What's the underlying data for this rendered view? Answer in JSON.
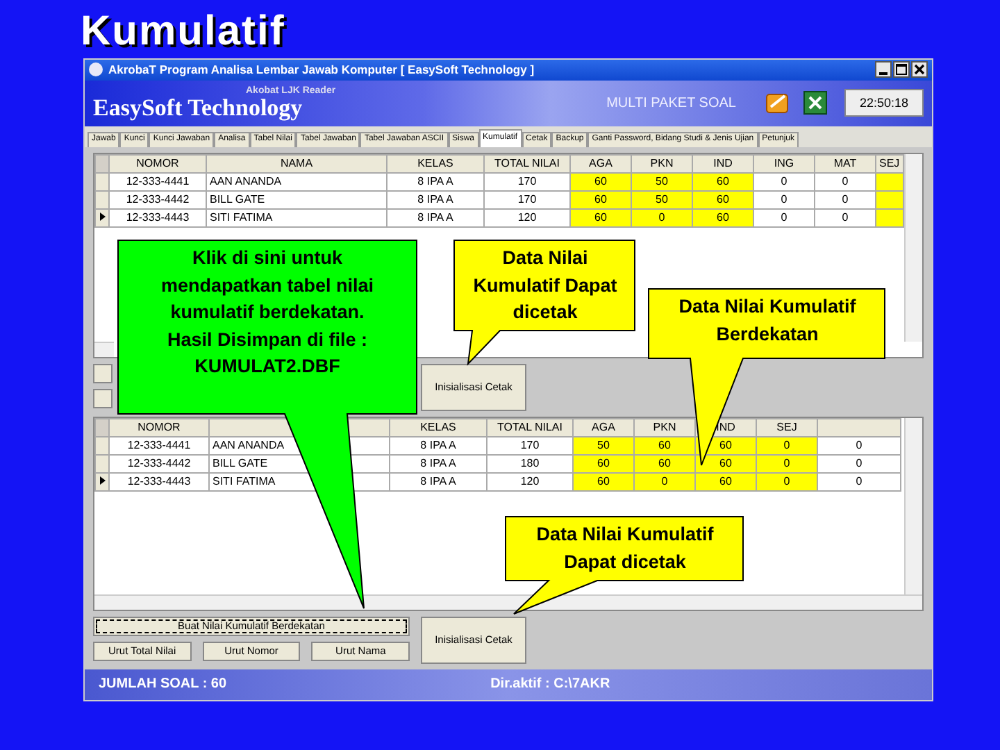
{
  "slide": {
    "title": "Kumulatif"
  },
  "window": {
    "title": "AkrobaT   Program Analisa Lembar Jawab Komputer  [ EasySoft Technology ]"
  },
  "header": {
    "subtitle": "Akobat LJK Reader",
    "brand": "EasySoft Technology",
    "label": "MULTI PAKET SOAL",
    "clock": "22:50:18"
  },
  "tabs": [
    {
      "label": "Jawab",
      "selected": false
    },
    {
      "label": "Kunci",
      "selected": false
    },
    {
      "label": "Kunci Jawaban",
      "selected": false
    },
    {
      "label": "Analisa",
      "selected": false
    },
    {
      "label": "Tabel Nilai",
      "selected": false
    },
    {
      "label": "Tabel Jawaban",
      "selected": false
    },
    {
      "label": "Tabel Jawaban ASCII",
      "selected": false
    },
    {
      "label": "Siswa",
      "selected": false
    },
    {
      "label": "Kumulatif",
      "selected": true
    },
    {
      "label": "Cetak",
      "selected": false
    },
    {
      "label": "Backup",
      "selected": false
    },
    {
      "label": "Ganti Password, Bidang Studi & Jenis Ujian",
      "selected": false
    },
    {
      "label": "Petunjuk",
      "selected": false
    }
  ],
  "grid_top": {
    "columns": [
      {
        "label": "NOMOR",
        "highlighted": false
      },
      {
        "label": "NAMA",
        "highlighted": false
      },
      {
        "label": "KELAS",
        "highlighted": false
      },
      {
        "label": "TOTAL NILAI",
        "highlighted": false
      },
      {
        "label": "AGA",
        "highlighted": true
      },
      {
        "label": "PKN",
        "highlighted": true
      },
      {
        "label": "IND",
        "highlighted": true
      },
      {
        "label": "ING",
        "highlighted": false
      },
      {
        "label": "MAT",
        "highlighted": false
      },
      {
        "label": "SEJ",
        "highlighted": true
      }
    ],
    "rows": [
      {
        "current": false,
        "cells": [
          "12-333-4441",
          "AAN ANANDA",
          "8 IPA A",
          "170",
          "60",
          "50",
          "60",
          "0",
          "0"
        ]
      },
      {
        "current": false,
        "cells": [
          "12-333-4442",
          "BILL GATE",
          "8 IPA A",
          "170",
          "60",
          "50",
          "60",
          "0",
          "0"
        ]
      },
      {
        "current": true,
        "cells": [
          "12-333-4443",
          "SITI FATIMA",
          "8 IPA A",
          "120",
          "60",
          "0",
          "60",
          "0",
          "0"
        ]
      }
    ]
  },
  "panel_top_buttons": [
    "Inisialisasi Cetak"
  ],
  "grid_bottom": {
    "columns": [
      {
        "label": "NOMOR",
        "highlighted": false
      },
      {
        "highlighted": false
      },
      {
        "label": "KELAS",
        "highlighted": false
      },
      {
        "label": "TOTAL NILAI",
        "highlighted": false
      },
      {
        "label": "AGA",
        "highlighted": true
      },
      {
        "label": "PKN",
        "highlighted": true
      },
      {
        "label": "IND",
        "highlighted": true
      },
      {
        "label": "SEJ",
        "highlighted": true
      },
      {
        "highlighted": false
      }
    ],
    "rows": [
      {
        "current": false,
        "cells": [
          "12-333-4441",
          "AAN ANANDA",
          "8 IPA A",
          "170",
          "50",
          "60",
          "60",
          "0",
          "0"
        ]
      },
      {
        "current": false,
        "cells": [
          "12-333-4442",
          "BILL GATE",
          "8 IPA A",
          "180",
          "60",
          "60",
          "60",
          "0",
          "0"
        ]
      },
      {
        "current": true,
        "cells": [
          "12-333-4443",
          "SITI FATIMA",
          "8 IPA A",
          "120",
          "60",
          "0",
          "60",
          "0",
          "0"
        ]
      }
    ]
  },
  "panel_bottom_buttons": [
    {
      "label": "Buat Nilai Kumulatif Berdekatan",
      "focused": true
    },
    {
      "label": "Urut Total Nilai",
      "focused": false
    },
    {
      "label": "Urut Nomor",
      "focused": false
    },
    {
      "label": "Urut Nama",
      "focused": false
    },
    {
      "label": "Inisialisasi Cetak",
      "focused": false
    }
  ],
  "status_bar": {
    "left": "JUMLAH SOAL : 60",
    "right": "Dir.aktif : C:\\7AKR"
  },
  "callouts": [
    {
      "text": "Klik di sini untuk mendapatkan tabel nilai kumulatif berdekatan. Hasil Disimpan di file : KUMULAT2.DBF",
      "color": "#00ff00"
    },
    {
      "text": "Data Nilai Kumulatif Dapat dicetak",
      "color": "#ffff00"
    },
    {
      "text": "Data Nilai Kumulatif Berdekatan",
      "color": "#ffff00"
    },
    {
      "text": "Data Nilai Kumulatif Dapat dicetak",
      "color": "#ffff00"
    }
  ]
}
